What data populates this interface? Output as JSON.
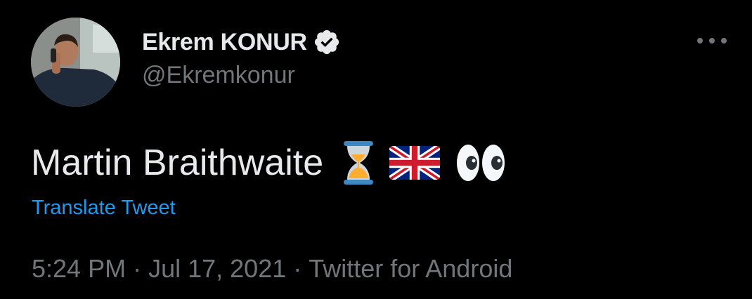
{
  "author": {
    "display_name": "Ekrem KONUR",
    "handle": "@Ekremkonur",
    "verified_icon": "verified-badge-icon",
    "avatar_icon": "profile-photo"
  },
  "tweet": {
    "text": "Martin Braithwaite",
    "emojis": [
      "hourglass-icon",
      "uk-flag-icon",
      "eyes-icon"
    ],
    "translate_label": "Translate Tweet"
  },
  "meta": {
    "time": "5:24 PM",
    "separator": "·",
    "date": "Jul 17, 2021",
    "source": "Twitter for Android"
  },
  "menu": {
    "icon": "more-options-icon"
  },
  "colors": {
    "background": "#000000",
    "primary_text": "#e7e9ea",
    "secondary_text": "#71767b",
    "link": "#1d9bf0"
  }
}
